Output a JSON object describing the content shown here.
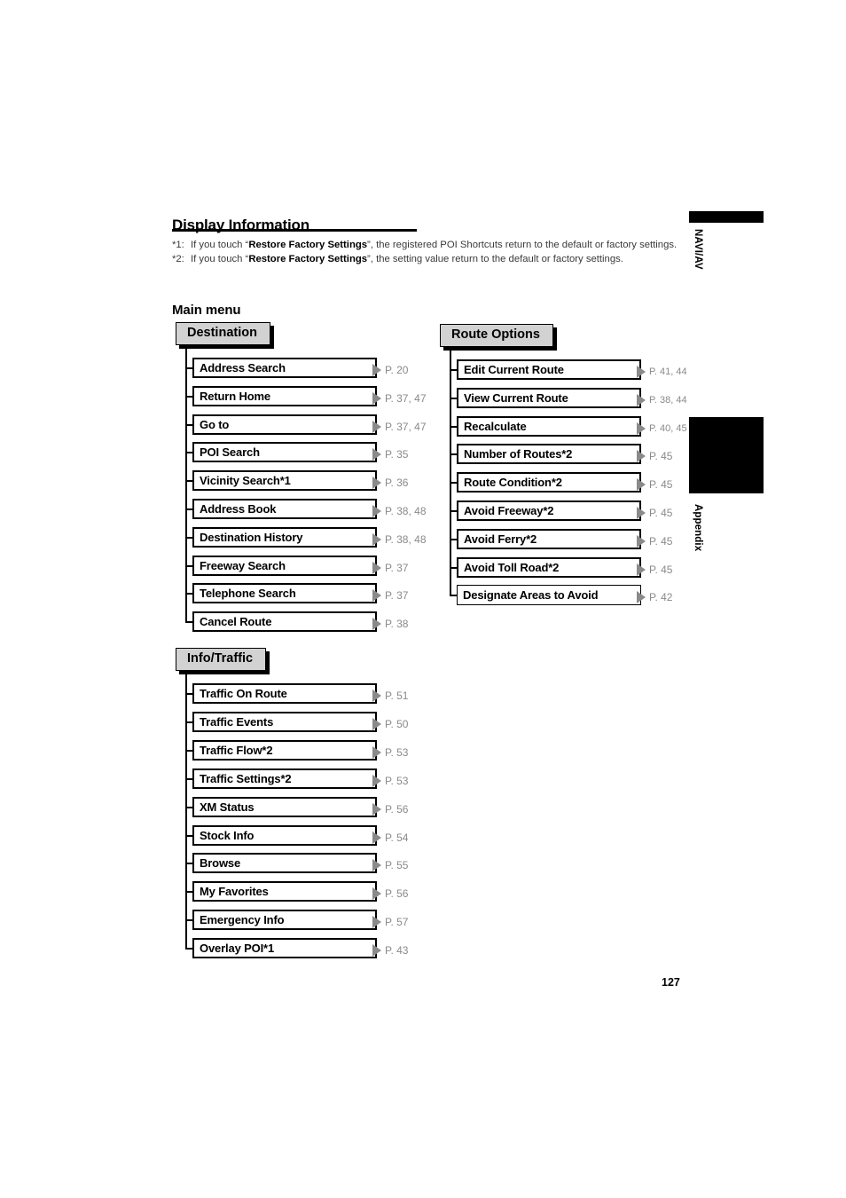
{
  "document": {
    "title": "Display Information",
    "sub_heading": "Main menu",
    "page_number": "127"
  },
  "footnotes": [
    {
      "mark": "*1:",
      "before": "If you touch “",
      "bold": "Restore Factory Settings",
      "after": "”, the registered POI Shortcuts return to the default or factory settings."
    },
    {
      "mark": "*2:",
      "before": "If you touch “",
      "bold": "Restore Factory Settings",
      "after": "”, the setting value return to the default or factory settings."
    }
  ],
  "side_tabs": [
    {
      "label": "NAVI/AV",
      "type": "bar"
    },
    {
      "label": "Appendix",
      "type": "block"
    }
  ],
  "groups": [
    {
      "id": "destination",
      "header": "Destination",
      "items": [
        {
          "label": "Address Search",
          "page_ref": "P. 20"
        },
        {
          "label": "Return Home",
          "page_ref": "P. 37, 47"
        },
        {
          "label": "Go to",
          "page_ref": "P. 37, 47"
        },
        {
          "label": "POI Search",
          "page_ref": "P. 35"
        },
        {
          "label": "Vicinity Search*1",
          "page_ref": "P. 36"
        },
        {
          "label": "Address Book",
          "page_ref": "P. 38, 48"
        },
        {
          "label": "Destination History",
          "page_ref": "P. 38, 48"
        },
        {
          "label": "Freeway Search",
          "page_ref": "P. 37"
        },
        {
          "label": "Telephone Search",
          "page_ref": "P. 37"
        },
        {
          "label": "Cancel Route",
          "page_ref": "P. 38"
        }
      ]
    },
    {
      "id": "route-options",
      "header": "Route Options",
      "items": [
        {
          "label": "Edit Current Route",
          "page_ref": "P. 41, 44",
          "tight": true
        },
        {
          "label": "View Current Route",
          "page_ref": "P. 38, 44",
          "tight": true
        },
        {
          "label": "Recalculate",
          "page_ref": "P. 40, 45",
          "tight": true
        },
        {
          "label": "Number of Routes*2",
          "page_ref": "P. 45"
        },
        {
          "label": "Route Condition*2",
          "page_ref": "P. 45"
        },
        {
          "label": "Avoid Freeway*2",
          "page_ref": "P. 45"
        },
        {
          "label": "Avoid Ferry*2",
          "page_ref": "P. 45"
        },
        {
          "label": "Avoid Toll Road*2",
          "page_ref": "P. 45"
        },
        {
          "label": "Designate Areas to Avoid",
          "page_ref": "P. 42",
          "thin": true
        }
      ]
    },
    {
      "id": "info-traffic",
      "header": "Info/Traffic",
      "items": [
        {
          "label": "Traffic On Route",
          "page_ref": "P. 51"
        },
        {
          "label": "Traffic Events",
          "page_ref": "P. 50"
        },
        {
          "label": "Traffic Flow*2",
          "page_ref": "P. 53"
        },
        {
          "label": "Traffic Settings*2",
          "page_ref": "P. 53"
        },
        {
          "label": "XM Status",
          "page_ref": "P. 56"
        },
        {
          "label": "Stock Info",
          "page_ref": "P. 54"
        },
        {
          "label": "Browse",
          "page_ref": "P. 55"
        },
        {
          "label": "My Favorites",
          "page_ref": "P. 56"
        },
        {
          "label": "Emergency Info",
          "page_ref": "P. 57"
        },
        {
          "label": "Overlay POI*1",
          "page_ref": "P. 43"
        }
      ]
    }
  ]
}
